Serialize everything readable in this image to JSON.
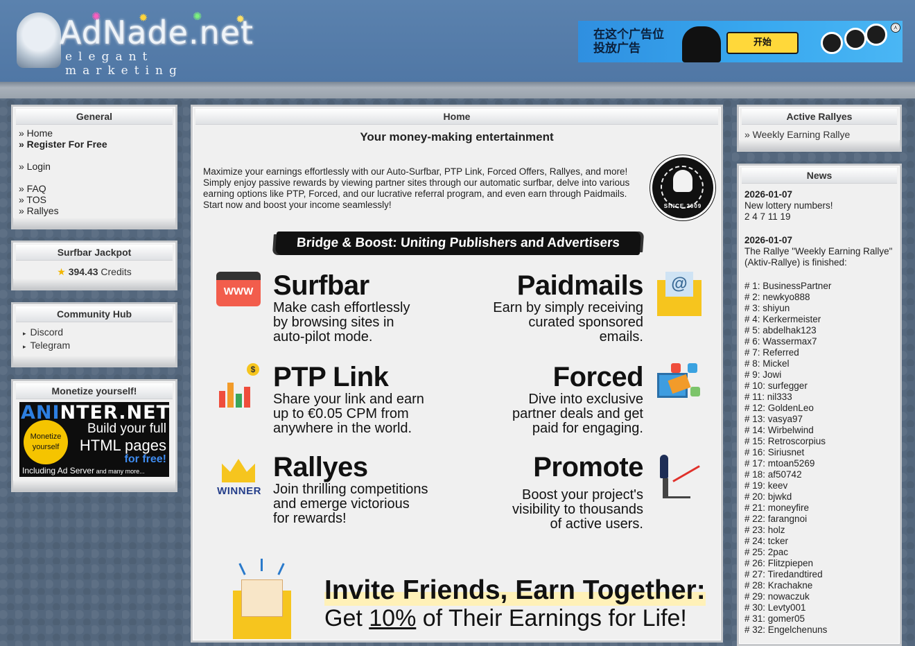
{
  "header": {
    "logo_title": "AdNade.net",
    "logo_tagline": "elegant marketing",
    "banner": {
      "text_line1": "在这个广告位",
      "text_line2": "投放广告",
      "button_label": "开始",
      "adchoices_glyph": "Ⓐ"
    }
  },
  "sidebar_left": {
    "general": {
      "title": "General",
      "items": [
        "» Home",
        "» Register For Free",
        "» Login",
        "» FAQ",
        "» TOS",
        "» Rallyes"
      ]
    },
    "jackpot": {
      "title": "Surfbar Jackpot",
      "amount": "394.43",
      "unit": " Credits"
    },
    "community": {
      "title": "Community Hub",
      "items": [
        "Discord",
        "Telegram"
      ]
    },
    "monetize": {
      "title": "Monetize yourself!",
      "ad": {
        "brand_a": "ANI",
        "brand_b": "NTER.NET",
        "seal_1": "Monetize",
        "seal_2": "yourself",
        "line1": "Build your full",
        "line2": "HTML pages",
        "line3": "for free!",
        "line4": "Including Ad Server",
        "line4_small": " and many more..."
      }
    }
  },
  "center": {
    "title": "Home",
    "slogan": "Your money-making entertainment",
    "intro": "Maximize your earnings effortlessly with our Auto-Surfbar, PTP Link, Forced Offers, Rallyes, and more! Simply enjoy passive rewards by viewing partner sites through our automatic surfbar, delve into various earning options like PTP, Forced, and our lucrative referral program, and even earn through Paidmails. Start now and boost your income seamlessly!",
    "badge_text": "SINCE 2009",
    "bridge": "Bridge & Boost: Uniting Publishers and Advertisers",
    "features": {
      "surfbar": {
        "title": "Surfbar",
        "desc": [
          "Make cash effortlessly",
          "by browsing sites in",
          "auto-pilot mode."
        ],
        "icon": "browser-www-icon",
        "icon_label": "WWW"
      },
      "paidmails": {
        "title": "Paidmails",
        "desc": [
          "Earn by simply receiving",
          "curated sponsored",
          "emails."
        ],
        "icon": "email-at-icon",
        "icon_label": "@"
      },
      "ptp": {
        "title": "PTP Link",
        "desc": [
          "Share your link and earn",
          "up to €0.05 CPM from",
          "anywhere in the world."
        ],
        "icon": "chart-coin-icon",
        "icon_label": "$"
      },
      "forced": {
        "title": "Forced",
        "desc": [
          "Dive into exclusive",
          "partner deals and get",
          "paid for engaging."
        ],
        "icon": "megaphone-icon"
      },
      "rallyes": {
        "title": "Rallyes",
        "desc": [
          "Join thrilling competitions",
          "and emerge victorious",
          "for rewards!"
        ],
        "icon": "crown-winner-icon",
        "icon_label": "WINNER"
      },
      "promote": {
        "title": "Promote",
        "desc": [
          "Boost your project's",
          "visibility to thousands",
          "of active users."
        ],
        "icon": "stairs-arrow-icon"
      }
    },
    "invite": {
      "title": "Invite Friends, Earn Together:",
      "sub_pre": "Get ",
      "sub_pct": "10%",
      "sub_post": " of Their Earnings for Life!"
    }
  },
  "sidebar_right": {
    "rallyes": {
      "title": "Active Rallyes",
      "link": "» Weekly Earning Rallye"
    },
    "news": {
      "title": "News",
      "entry1": {
        "date": "2026-01-07",
        "line1": "New lottery numbers!",
        "line2": "2 4 7 11 19"
      },
      "entry2": {
        "date": "2026-01-07",
        "line1": "The Rallye \"Weekly Earning Rallye\" (Aktiv-Rallye) is finished:"
      },
      "ranks": [
        "# 1: BusinessPartner",
        "# 2: newkyo888",
        "# 3: shiyun",
        "# 4: Kerkermeister",
        "# 5: abdelhak123",
        "# 6: Wassermax7",
        "# 7: Referred",
        "# 8: Mickel",
        "# 9: Jowi",
        "# 10: surfegger",
        "# 11: nil333",
        "# 12: GoldenLeo",
        "# 13: vasya97",
        "# 14: Wirbelwind",
        "# 15: Retroscorpius",
        "# 16: Siriusnet",
        "# 17: mtoan5269",
        "# 18: af50742",
        "# 19: keev",
        "# 20: bjwkd",
        "# 21: moneyfire",
        "# 22: farangnoi",
        "# 23: holz",
        "# 24: tcker",
        "# 25: 2pac",
        "# 26: Flitzpiepen",
        "# 27: Tiredandtired",
        "# 28: Krachakne",
        "# 29: nowaczuk",
        "# 30: Levty001",
        "# 31: gomer05",
        "# 32: Engelchenuns"
      ]
    }
  }
}
